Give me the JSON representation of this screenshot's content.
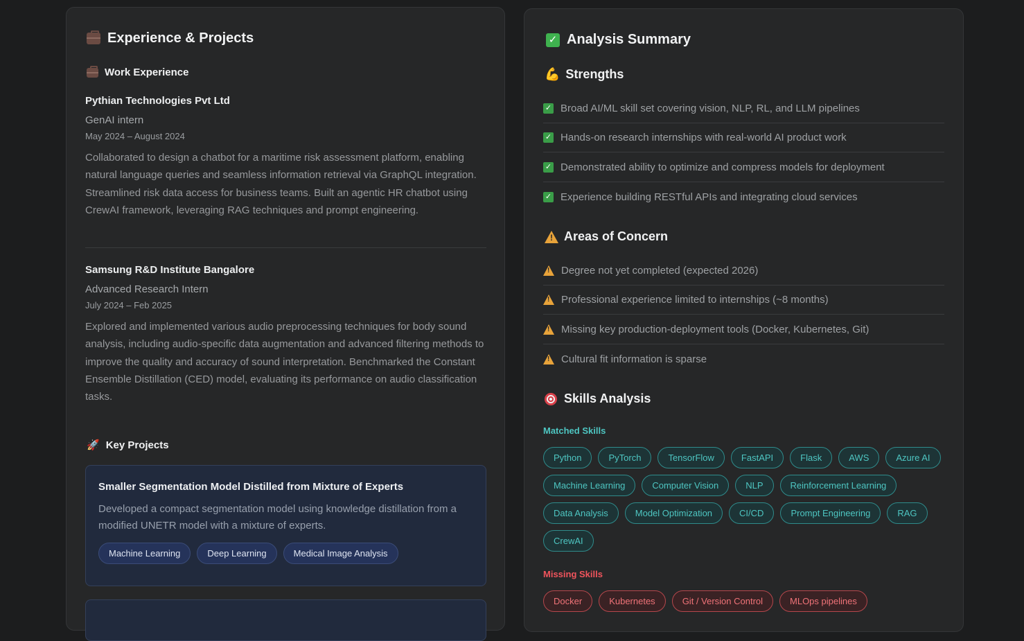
{
  "left": {
    "title": "Experience & Projects",
    "work_heading": "Work Experience",
    "jobs": [
      {
        "company": "Pythian Technologies Pvt Ltd",
        "role": "GenAI intern",
        "dates": "May 2024 – August 2024",
        "description": "Collaborated to design a chatbot for a maritime risk assessment platform, enabling natural language queries and seamless information retrieval via GraphQL integration. Streamlined risk data access for business teams. Built an agentic HR chatbot using CrewAI framework, leveraging RAG techniques and prompt engineering."
      },
      {
        "company": "Samsung R&D Institute Bangalore",
        "role": "Advanced Research Intern",
        "dates": "July 2024 – Feb 2025",
        "description": "Explored and implemented various audio preprocessing techniques for body sound analysis, including audio-specific data augmentation and advanced filtering methods to improve the quality and accuracy of sound interpretation. Benchmarked the Constant Ensemble Distillation (CED) model, evaluating its performance on audio classification tasks."
      }
    ],
    "projects_heading": "Key Projects",
    "projects": [
      {
        "title": "Smaller Segmentation Model Distilled from Mixture of Experts",
        "description": "Developed a compact segmentation model using knowledge distillation from a modified UNETR model with a mixture of experts.",
        "tags": [
          "Machine Learning",
          "Deep Learning",
          "Medical Image Analysis"
        ]
      }
    ]
  },
  "right": {
    "title": "Analysis Summary",
    "strengths_heading": "Strengths",
    "strengths": [
      "Broad AI/ML skill set covering vision, NLP, RL, and LLM pipelines",
      "Hands-on research internships with real-world AI product work",
      "Demonstrated ability to optimize and compress models for deployment",
      "Experience building RESTful APIs and integrating cloud services"
    ],
    "concerns_heading": "Areas of Concern",
    "concerns": [
      "Degree not yet completed (expected 2026)",
      "Professional experience limited to internships (~8 months)",
      "Missing key production-deployment tools (Docker, Kubernetes, Git)",
      "Cultural fit information is sparse"
    ],
    "skills_heading": "Skills Analysis",
    "matched_label": "Matched Skills",
    "matched_skills": [
      "Python",
      "PyTorch",
      "TensorFlow",
      "FastAPI",
      "Flask",
      "AWS",
      "Azure AI",
      "Machine Learning",
      "Computer Vision",
      "NLP",
      "Reinforcement Learning",
      "Data Analysis",
      "Model Optimization",
      "CI/CD",
      "Prompt Engineering",
      "RAG",
      "CrewAI"
    ],
    "missing_label": "Missing Skills",
    "missing_skills": [
      "Docker",
      "Kubernetes",
      "Git / Version Control",
      "MLOps pipelines"
    ]
  },
  "colors": {
    "matched": "#4ec6c2",
    "missing": "#f07378",
    "project_card": "#212a3d"
  }
}
